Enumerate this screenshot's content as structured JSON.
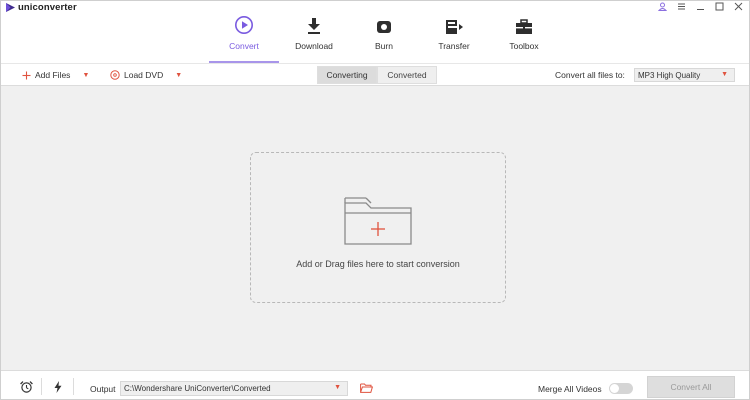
{
  "app": {
    "name": "uniconverter"
  },
  "nav": {
    "items": [
      {
        "label": "Convert",
        "icon": "play-circle-icon",
        "active": true
      },
      {
        "label": "Download",
        "icon": "download-icon",
        "active": false
      },
      {
        "label": "Burn",
        "icon": "disc-icon",
        "active": false
      },
      {
        "label": "Transfer",
        "icon": "transfer-icon",
        "active": false
      },
      {
        "label": "Toolbox",
        "icon": "toolbox-icon",
        "active": false
      }
    ]
  },
  "toolbar": {
    "add_files": "Add Files",
    "load_dvd": "Load DVD",
    "tabs": [
      {
        "label": "Converting",
        "active": true
      },
      {
        "label": "Converted",
        "active": false
      }
    ],
    "convert_all_label": "Convert all files to:",
    "format_value": "MP3 High Quality"
  },
  "dropzone": {
    "text": "Add or Drag files here to start conversion"
  },
  "bottom": {
    "output_label": "Output",
    "output_path": "C:\\Wondershare UniConverter\\Converted",
    "merge_label": "Merge All Videos",
    "merge_on": false,
    "convert_all_button": "Convert All"
  },
  "colors": {
    "accent": "#7a5be0",
    "orange": "#e0533f"
  }
}
